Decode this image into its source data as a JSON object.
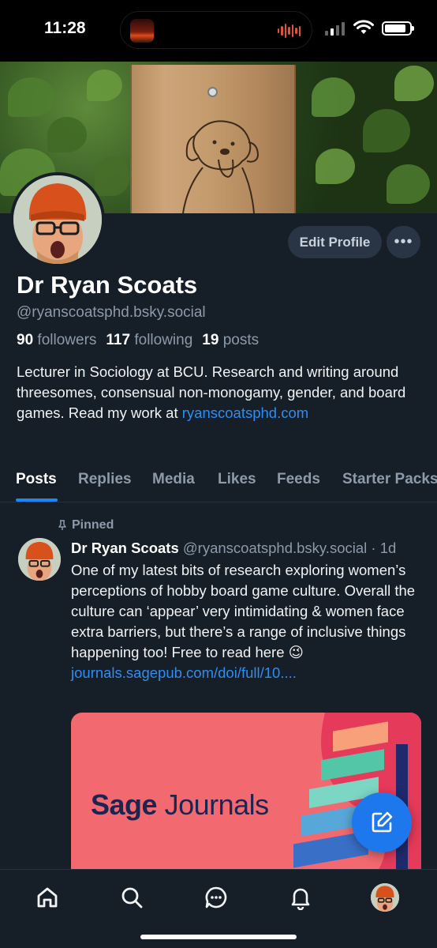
{
  "status_bar": {
    "time": "11:28"
  },
  "profile": {
    "display_name": "Dr Ryan Scoats",
    "handle": "@ryanscoatsphd.bsky.social",
    "followers_count": "90",
    "followers_label": "followers",
    "following_count": "117",
    "following_label": "following",
    "posts_count": "19",
    "posts_label": "posts",
    "bio": "Lecturer in Sociology at BCU. Research and writing around threesomes, consensual non-monogamy, gender, and board games. Read my work at",
    "bio_link": "ryanscoatsphd.com",
    "edit_label": "Edit Profile",
    "more_label": "•••"
  },
  "tabs": [
    {
      "label": "Posts",
      "active": true
    },
    {
      "label": "Replies",
      "active": false
    },
    {
      "label": "Media",
      "active": false
    },
    {
      "label": "Likes",
      "active": false
    },
    {
      "label": "Feeds",
      "active": false
    },
    {
      "label": "Starter Packs",
      "active": false
    }
  ],
  "post": {
    "pinned_label": "Pinned",
    "author": "Dr Ryan Scoats",
    "handle": "@ryanscoatsphd.bsky.social",
    "separator": "·",
    "age": "1d",
    "text": "One of my latest bits of research exploring women’s perceptions of hobby board game culture. Overall the culture can ‘appear’ very intimidating & women face extra barriers, but there’s a range of inclusive things happening too! Free to read here 😉",
    "link": "journals.sagepub.com/doi/full/10....",
    "embed_brand_bold": "Sage",
    "embed_brand_light": "Journals"
  },
  "colors": {
    "accent": "#1f86f0",
    "background": "#161e27",
    "embed_bg": "#f26a6f"
  },
  "icons": [
    "home-icon",
    "search-icon",
    "chat-icon",
    "bell-icon",
    "compose-icon",
    "pin-icon",
    "more-icon"
  ]
}
